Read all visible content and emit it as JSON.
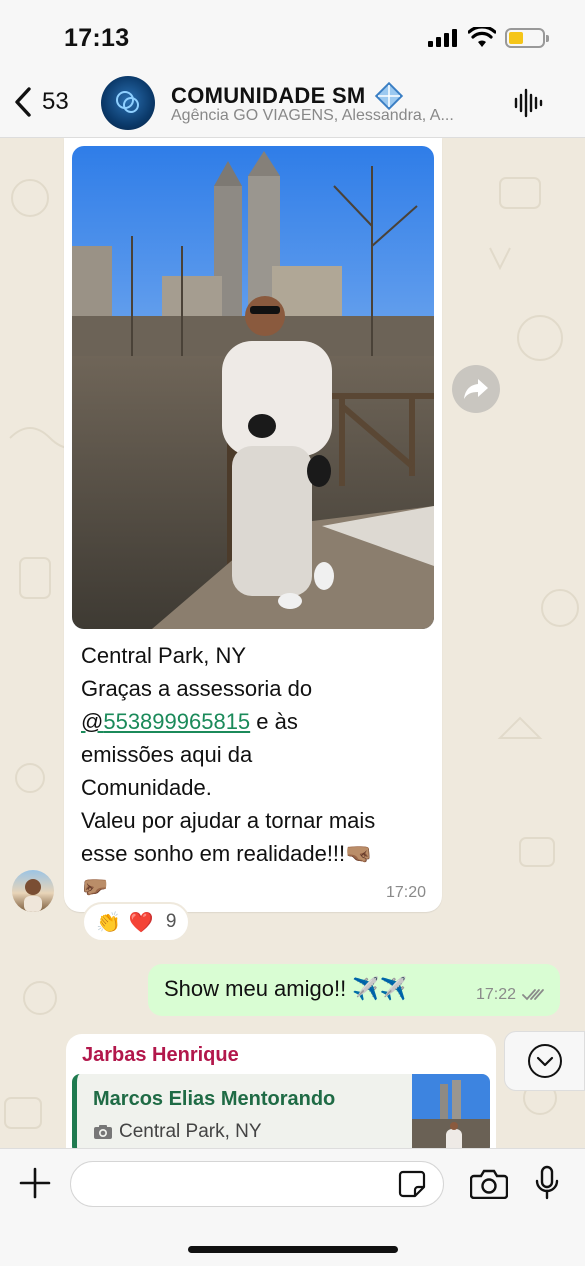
{
  "status_bar": {
    "time": "17:13",
    "battery_level": 0.4
  },
  "header": {
    "back_count": "53",
    "group_name": "COMUNIDADE SM",
    "group_badge_icon": "diamond-icon",
    "members": "Agência GO VIAGENS, Alessandra, A..."
  },
  "message_in": {
    "caption_line1": "Central Park, NY",
    "caption_line2": "Graças a assessoria do",
    "mention_prefix": "@",
    "mention": "553899965815",
    "after_mention": " e às",
    "caption_line4": "emissões aqui da",
    "caption_line5": "Comunidade.",
    "caption_line6": "Valeu por ajudar a tornar mais",
    "caption_line7": "esse sonho em realidade!!!🤜🏽",
    "caption_line8": "🤛🏽",
    "time": "17:20",
    "reactions": {
      "emoji1": "👏",
      "emoji2": "❤️",
      "count": "9"
    }
  },
  "message_out": {
    "text": "Show meu amigo!! ✈️✈️",
    "time": "17:22",
    "status": "read"
  },
  "message_quote": {
    "sender": "Jarbas Henrique",
    "quoted_author": "Marcos Elias Mentorando",
    "quoted_text": "Central Park, NY"
  },
  "input": {
    "placeholder": ""
  },
  "colors": {
    "outgoing_bubble": "#d9fdd3",
    "sender_name": "#b2174b",
    "quote_author": "#1f6b45",
    "mention": "#1b8a5a"
  }
}
